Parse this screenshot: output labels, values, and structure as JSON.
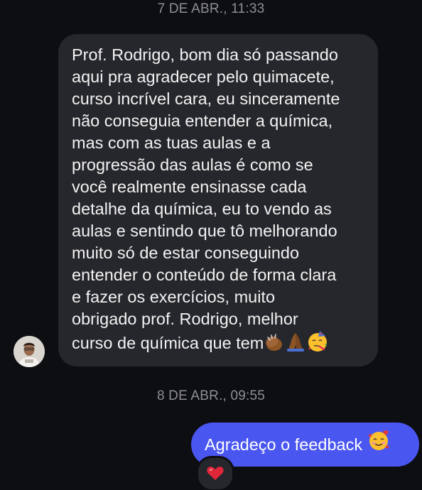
{
  "timestamps": {
    "first": "7 DE ABR., 11:33",
    "second": "8 DE ABR., 09:55"
  },
  "incoming_message": {
    "lines": [
      "Prof. Rodrigo, bom dia só passando",
      "aqui pra agradecer pelo quimacete,",
      "curso incrível cara, eu sinceramente",
      "não conseguia entender a química,",
      "mas com as tuas aulas e a",
      "progressão das aulas é como se",
      "você realmente ensinasse cada",
      "detalhe da química, eu to vendo as",
      "aulas e sentindo que tô melhorando",
      "muito só de estar conseguindo",
      "entender o conteúdo de forma clara",
      "e fazer os exercícios, muito",
      "obrigado prof. Rodrigo, melhor",
      "curso de química que tem"
    ],
    "trailing_emojis": [
      "clapping-hands-icon",
      "folded-hands-icon",
      "partying-face-icon"
    ]
  },
  "outgoing_message": {
    "text": "Agradeço o feedback",
    "emoji": "smiling-face-with-hearts-icon"
  },
  "reaction": {
    "emoji": "red-heart-icon"
  },
  "colors": {
    "background": "#0d0e12",
    "incoming_bubble": "#26272c",
    "outgoing_bubble": "#4a56f0",
    "timestamp_text": "#8e8e93",
    "heart": "#e0273a"
  }
}
